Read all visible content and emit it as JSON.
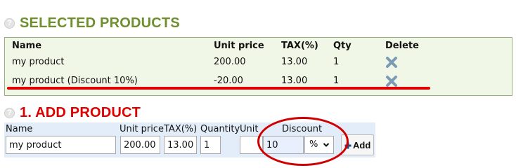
{
  "selected": {
    "title": "SELECTED PRODUCTS",
    "headers": {
      "name": "Name",
      "price": "Unit price",
      "tax": "TAX(%)",
      "qty": "Qty",
      "delete": "Delete"
    },
    "rows": [
      {
        "name": "my product",
        "price": "200.00",
        "tax": "13.00",
        "qty": "1",
        "delete_icon": "close-icon"
      },
      {
        "name": "my product (Discount 10%)",
        "price": "-20.00",
        "tax": "13.00",
        "qty": "1",
        "delete_icon": "close-icon"
      }
    ]
  },
  "add": {
    "title": "1. ADD PRODUCT",
    "labels": {
      "name": "Name",
      "price": "Unit price",
      "tax": "TAX(%)",
      "quantity": "Quantity",
      "unit": "Unit",
      "discount": "Discount"
    },
    "values": {
      "name": "my product",
      "price": "200.00",
      "tax": "13.00",
      "quantity": "1",
      "unit": "",
      "discount": "10",
      "discount_type": "%"
    },
    "add_label": "Add"
  },
  "icons": {
    "help": "help-icon",
    "delete": "close-icon",
    "add": "plus-icon",
    "select": "chevron-down-icon"
  },
  "colors": {
    "selected_title": "#6f8f2f",
    "add_title": "#e00000",
    "delete_icon": "#7b9bb5",
    "annotation": "#d10000"
  }
}
